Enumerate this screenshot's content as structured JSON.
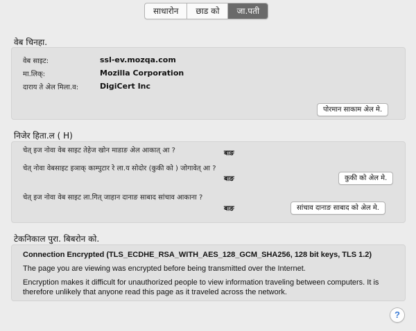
{
  "tabs": [
    {
      "label": "साधारोन"
    },
    {
      "label": "छाड को"
    },
    {
      "label": "जा.पती"
    }
  ],
  "active_tab_index": 2,
  "website_identity": {
    "heading": "वेब चिनहा.",
    "rows": [
      {
        "label": "वेब साइट:",
        "value": "ssl-ev.mozqa.com"
      },
      {
        "label": "मा.लिक्:",
        "value": "Mozilla Corporation"
      },
      {
        "label": "दाराय ते अेल मिला.व:",
        "value": "DigiCert Inc"
      }
    ],
    "view_certificate_button": "पोरमान साकाम अेल मे."
  },
  "privacy_history": {
    "heading": "निजेर हिता.ल ( H)",
    "rows": [
      {
        "question": "चेत् इज नोवा वेब साइट तेहेज खोन माडाङ अेल आकात् आ ?",
        "answer": "बाङ",
        "button": ""
      },
      {
        "question": "चेत् नोवा वेबसाइट इञाक् काम्पुटार रे ला.य सोदोर (कुकी को ) जोगावेत् आ ?",
        "answer": "बाङ",
        "button": "कुकी को अेल मे."
      },
      {
        "question": "चेत् इज नोवा वेब साइट ला.गित् जाहान दानाङ साबाद सांचाव आकाना ?",
        "answer": "बाङ",
        "button": "सांचाव दानाङ साबाद को अेल मे."
      }
    ]
  },
  "technical_details": {
    "heading": "टेकनिकाल पुरा. बिबरोन को.",
    "title": "Connection Encrypted (TLS_ECDHE_RSA_WITH_AES_128_GCM_SHA256, 128 bit keys, TLS 1.2)",
    "line1": "The page you are viewing was encrypted before being transmitted over the Internet.",
    "line2": "Encryption makes it difficult for unauthorized people to view information traveling between computers. It is therefore unlikely that anyone read this page as it traveled across the network."
  },
  "help_button": "?"
}
